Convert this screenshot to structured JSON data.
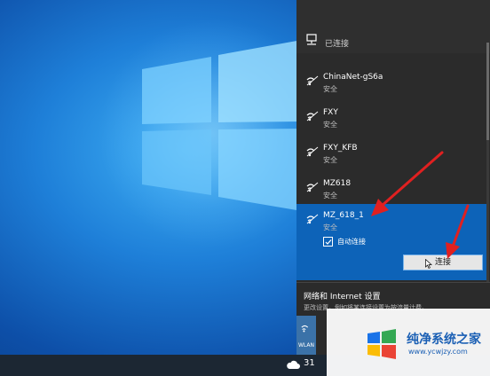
{
  "network_panel": {
    "connected_label": "已连接",
    "networks": [
      {
        "name": "ChinaNet-gS6a",
        "security": "安全"
      },
      {
        "name": "FXY",
        "security": "安全"
      },
      {
        "name": "FXY_KFB",
        "security": "安全"
      },
      {
        "name": "MZ618",
        "security": "安全"
      },
      {
        "name": "MZ_618_1",
        "security": "安全"
      }
    ],
    "auto_connect_label": "自动连接",
    "auto_connect_checked": true,
    "connect_button_label": "连接",
    "settings_title": "网络和 Internet 设置",
    "settings_desc": "更改设置，例如将某连接设置为按流量计费。",
    "quick_tile_label": "WLAN"
  },
  "taskbar": {
    "temperature": "31"
  },
  "watermark": {
    "title": "纯净系统之家",
    "url": "www.ycwjzy.com"
  },
  "colors": {
    "selected_bg": "#0d63b8",
    "panel_bg": "#2b2b2b",
    "arrow": "#e02020"
  }
}
